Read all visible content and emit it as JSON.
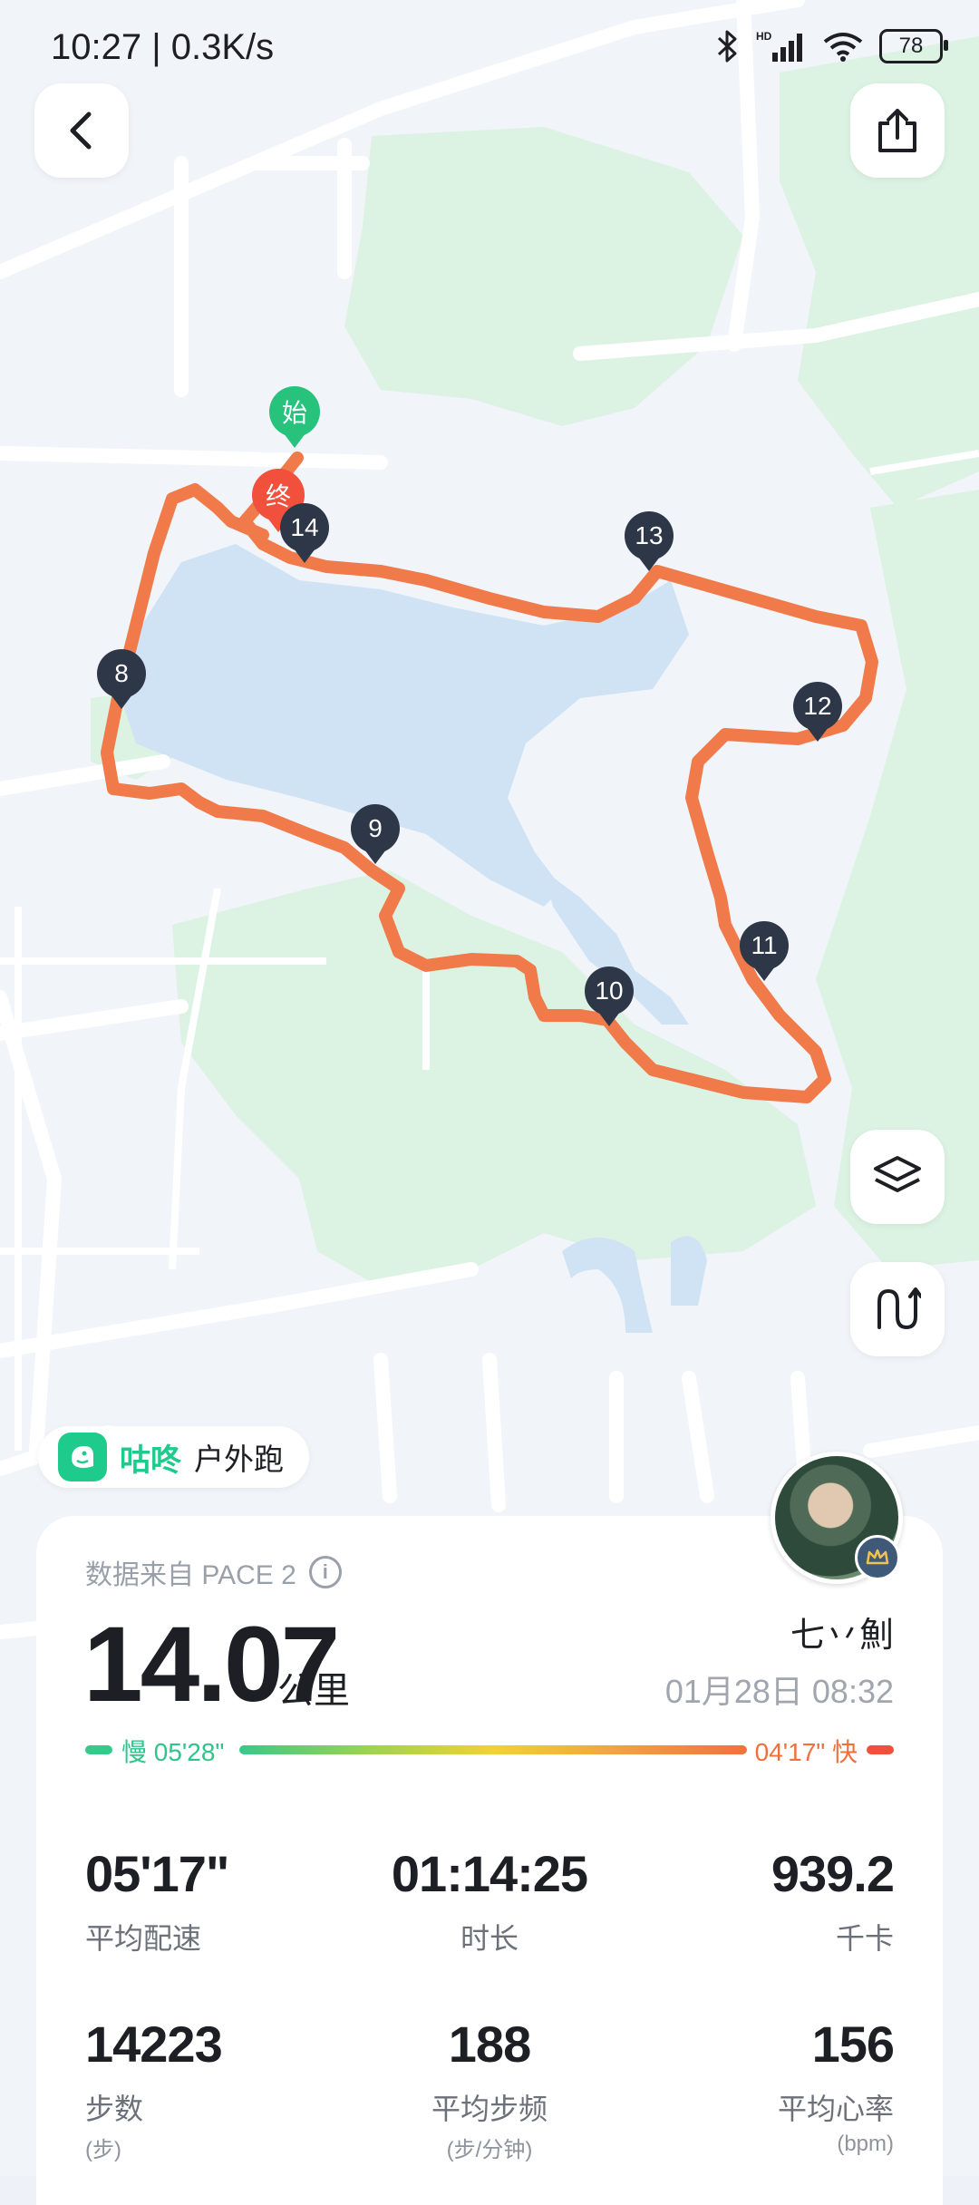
{
  "status_bar": {
    "time_speed": "10:27 | 0.3K/s",
    "battery": "78",
    "icons": [
      "bluetooth-icon",
      "hd-signal-icon",
      "wifi-icon",
      "battery-icon"
    ]
  },
  "top_bar": {
    "back_icon": "chevron-left-icon",
    "share_icon": "share-icon"
  },
  "map": {
    "start_label": "始",
    "end_label": "终",
    "km_markers": [
      "8",
      "9",
      "10",
      "11",
      "12",
      "13",
      "14"
    ],
    "route_color": "#f07a4a",
    "side_buttons": [
      "layers-icon",
      "pace-curve-icon"
    ]
  },
  "app": {
    "name": "咕咚",
    "activity": "户外跑",
    "brand_color": "#1fcb8c"
  },
  "summary": {
    "source": "数据来自 PACE 2",
    "distance": "14.07",
    "distance_unit": "公里",
    "username": "七丷魝",
    "datetime": "01月28日 08:32",
    "pace_slow": "慢 05'28\"",
    "pace_fast": "04'17\" 快"
  },
  "stats": [
    {
      "value": "05'17\"",
      "label": "平均配速",
      "unit": ""
    },
    {
      "value": "01:14:25",
      "label": "时长",
      "unit": ""
    },
    {
      "value": "939.2",
      "label": "千卡",
      "unit": ""
    },
    {
      "value": "14223",
      "label": "步数",
      "unit": "(步)"
    },
    {
      "value": "188",
      "label": "平均步频",
      "unit": "(步/分钟)"
    },
    {
      "value": "156",
      "label": "平均心率",
      "unit": "(bpm)"
    }
  ]
}
